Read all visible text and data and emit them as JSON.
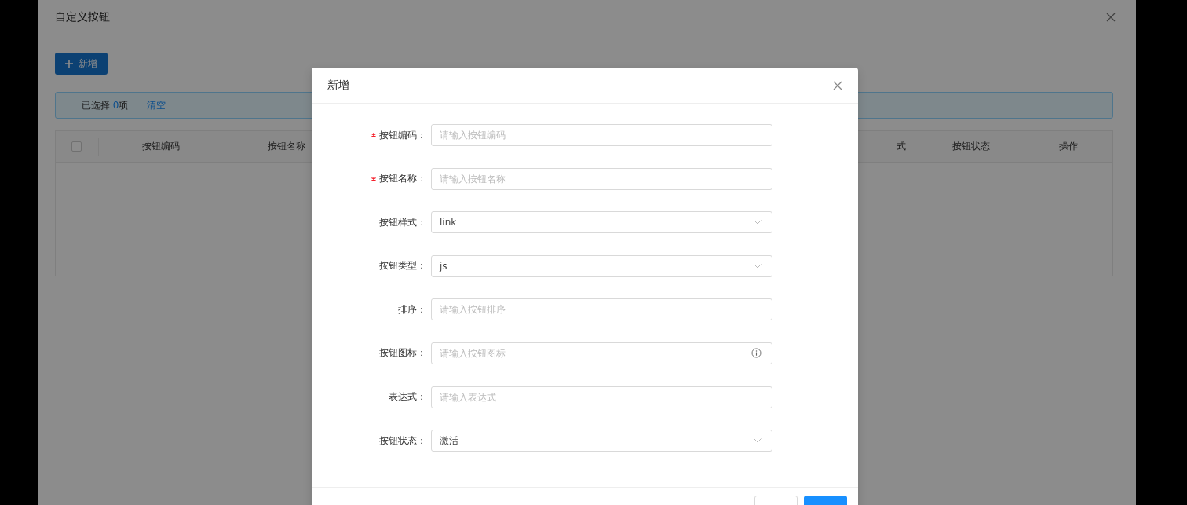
{
  "page": {
    "title": "自定义按钮"
  },
  "add_button": {
    "label": "新增"
  },
  "selection": {
    "prefix": "已选择",
    "count": "0",
    "suffix": "项",
    "clear": "清空"
  },
  "table": {
    "select_all": {
      "checked": false
    },
    "columns": [
      {
        "label": "按钮编码"
      },
      {
        "label": "按钮名称"
      },
      {
        "label": "式"
      },
      {
        "label": "按钮状态"
      },
      {
        "label": "操作"
      }
    ]
  },
  "dialog": {
    "title": "新增",
    "fields": [
      {
        "label": "按钮编码：",
        "required": true,
        "kind": "input",
        "placeholder": "请输入按钮编码"
      },
      {
        "label": "按钮名称：",
        "required": true,
        "kind": "input",
        "placeholder": "请输入按钮名称"
      },
      {
        "label": "按钮样式：",
        "required": false,
        "kind": "select",
        "value": "link"
      },
      {
        "label": "按钮类型：",
        "required": false,
        "kind": "select",
        "value": "js"
      },
      {
        "label": "排序：",
        "required": false,
        "kind": "input",
        "placeholder": "请输入按钮排序"
      },
      {
        "label": "按钮图标：",
        "required": false,
        "kind": "icon_input",
        "placeholder": "请输入按钮图标"
      },
      {
        "label": "表达式：",
        "required": false,
        "kind": "input",
        "placeholder": "请输入表达式"
      },
      {
        "label": "按钮状态：",
        "required": false,
        "kind": "select",
        "value": "激活"
      }
    ]
  }
}
